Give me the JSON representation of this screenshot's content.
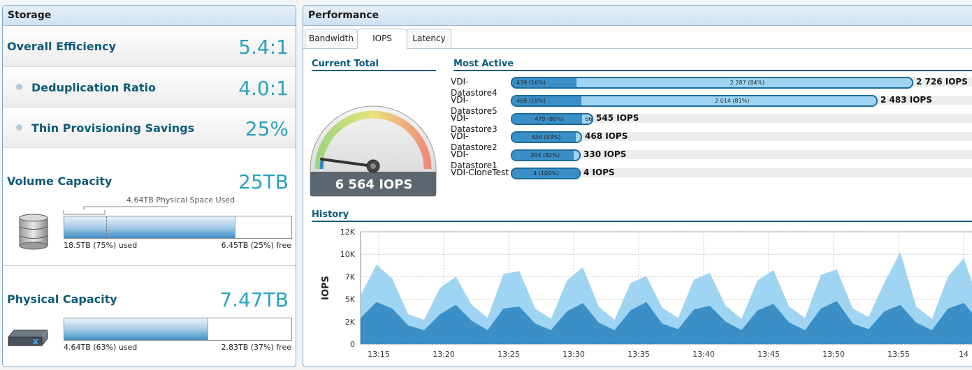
{
  "storage": {
    "title": "Storage",
    "overall": {
      "label": "Overall Efficiency",
      "value": "5.4:1"
    },
    "dedup": {
      "label": "Deduplication Ratio",
      "value": "4.0:1"
    },
    "thin": {
      "label": "Thin Provisioning Savings",
      "value": "25%"
    },
    "volume": {
      "label": "Volume Capacity",
      "value": "25TB",
      "physical_used_note": "4.64TB Physical Space Used",
      "used_text": "18.5TB (75%) used",
      "free_text": "6.45TB (25%) free",
      "used_fraction": 0.75,
      "physical_fraction": 0.186
    },
    "physical": {
      "label": "Physical Capacity",
      "value": "7.47TB",
      "used_text": "4.64TB (63%) used",
      "free_text": "2.83TB (37%) free",
      "used_fraction": 0.63
    }
  },
  "performance": {
    "title": "Performance",
    "tabs": [
      "Bandwidth",
      "IOPS",
      "Latency"
    ],
    "active_tab": "IOPS",
    "current_total": {
      "title": "Current Total",
      "value": "6 564 IOPS"
    },
    "most_active": {
      "title": "Most Active",
      "rows": [
        {
          "name": "VDI-Datastore4",
          "seg1_label": "439 (16%)",
          "seg2_label": "2 287 (84%)",
          "seg1_fraction": 0.16,
          "total": "2 726 IOPS",
          "total_value": 2726
        },
        {
          "name": "VDI-Datastore5",
          "seg1_label": "469 (19%)",
          "seg2_label": "2 014 (81%)",
          "seg1_fraction": 0.19,
          "total": "2 483 IOPS",
          "total_value": 2483
        },
        {
          "name": "VDI-Datastore3",
          "seg1_label": "479 (88%)",
          "seg2_label": "66 (12%)",
          "seg1_fraction": 0.88,
          "total": "545 IOPS",
          "total_value": 545
        },
        {
          "name": "VDI-Datastore2",
          "seg1_label": "434 (93%)",
          "seg2_label": "",
          "seg1_fraction": 0.93,
          "total": "468 IOPS",
          "total_value": 468
        },
        {
          "name": "VDI-Datastore1",
          "seg1_label": "304 (92%)",
          "seg2_label": "",
          "seg1_fraction": 0.92,
          "total": "330 IOPS",
          "total_value": 330
        },
        {
          "name": "VDI-CloneTest",
          "seg1_label": "4 (100%)",
          "seg2_label": "",
          "seg1_fraction": 1.0,
          "total": "4 IOPS",
          "total_value": 4
        }
      ]
    },
    "history": {
      "title": "History",
      "ylabel": "IOPS"
    }
  },
  "chart_data": {
    "type": "area",
    "ylabel": "IOPS",
    "ylim": [
      0,
      12000
    ],
    "yticks": [
      "0",
      "2K",
      "5K",
      "7K",
      "10K",
      "12K"
    ],
    "xticks": [
      "13:15",
      "13:20",
      "13:25",
      "13:30",
      "13:35",
      "13:40",
      "13:45",
      "13:50",
      "13:55",
      "14"
    ],
    "grid": true,
    "series": [
      {
        "values": [
          2800,
          4500,
          3800,
          2000,
          1500,
          3200,
          4200,
          2500,
          1500,
          3800,
          4000,
          2200,
          1500,
          3500,
          4400,
          2300,
          1500,
          3600,
          4500,
          2200,
          1600,
          3700,
          4100,
          2400,
          1500,
          3600,
          4300,
          2300,
          1500,
          3800,
          4600,
          2200,
          1600,
          3500,
          4200,
          2300,
          1500,
          3800,
          4400,
          2400
        ]
      },
      {
        "values": [
          5200,
          8500,
          7000,
          3200,
          2600,
          6000,
          7200,
          4200,
          2800,
          7500,
          7800,
          3800,
          2700,
          6800,
          8200,
          4000,
          2600,
          6500,
          7300,
          3900,
          2800,
          6900,
          7600,
          4100,
          2700,
          6800,
          7900,
          4000,
          2800,
          7400,
          8000,
          3800,
          2900,
          6600,
          9800,
          4000,
          2700,
          7200,
          9200,
          4200
        ]
      }
    ]
  },
  "colors": {
    "accent": "#2aa1bf",
    "label": "#0d5a78",
    "bar_dark": "#3a8fc7",
    "bar_light": "#9fd4f2"
  },
  "icons": {
    "volume": "database-icon",
    "physical": "server-icon"
  }
}
